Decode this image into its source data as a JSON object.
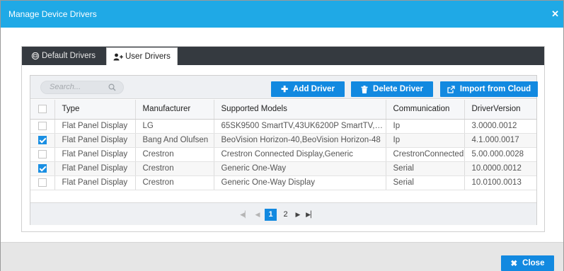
{
  "dialog": {
    "title": "Manage Device Drivers",
    "close_icon": "close-icon",
    "close_label": "Close"
  },
  "tabs": [
    {
      "label": "Default Drivers",
      "icon": "monitor-icon",
      "active": false
    },
    {
      "label": "User Drivers",
      "icon": "add-user-icon",
      "active": true
    }
  ],
  "toolbar": {
    "search_placeholder": "Search...",
    "add_label": "Add Driver",
    "delete_label": "Delete Driver",
    "import_label": "Import from Cloud"
  },
  "table": {
    "columns": [
      "Type",
      "Manufacturer",
      "Supported Models",
      "Communication",
      "DriverVersion"
    ],
    "rows": [
      {
        "checked": false,
        "type": "Flat Panel Display",
        "manufacturer": "LG",
        "models": "65SK9500 SmartTV,43UK6200P SmartTV,43...",
        "communication": "Ip",
        "version": "3.0000.0012"
      },
      {
        "checked": true,
        "type": "Flat Panel Display",
        "manufacturer": "Bang And Olufsen",
        "models": "BeoVision Horizon-40,BeoVision Horizon-48",
        "communication": "Ip",
        "version": "4.1.000.0017"
      },
      {
        "checked": false,
        "type": "Flat Panel Display",
        "manufacturer": "Crestron",
        "models": "Crestron Connected Display,Generic",
        "communication": "CrestronConnected",
        "version": "5.00.000.0028"
      },
      {
        "checked": true,
        "type": "Flat Panel Display",
        "manufacturer": "Crestron",
        "models": "Generic One-Way",
        "communication": "Serial",
        "version": "10.0000.0012"
      },
      {
        "checked": false,
        "type": "Flat Panel Display",
        "manufacturer": "Crestron",
        "models": "Generic One-Way Display",
        "communication": "Serial",
        "version": "10.0100.0013"
      }
    ]
  },
  "pager": {
    "pages": [
      "1",
      "2"
    ],
    "current": "1"
  },
  "colors": {
    "title_bar": "#1fa9e6",
    "accent": "#1289e0",
    "tab_bar": "#353a40"
  }
}
